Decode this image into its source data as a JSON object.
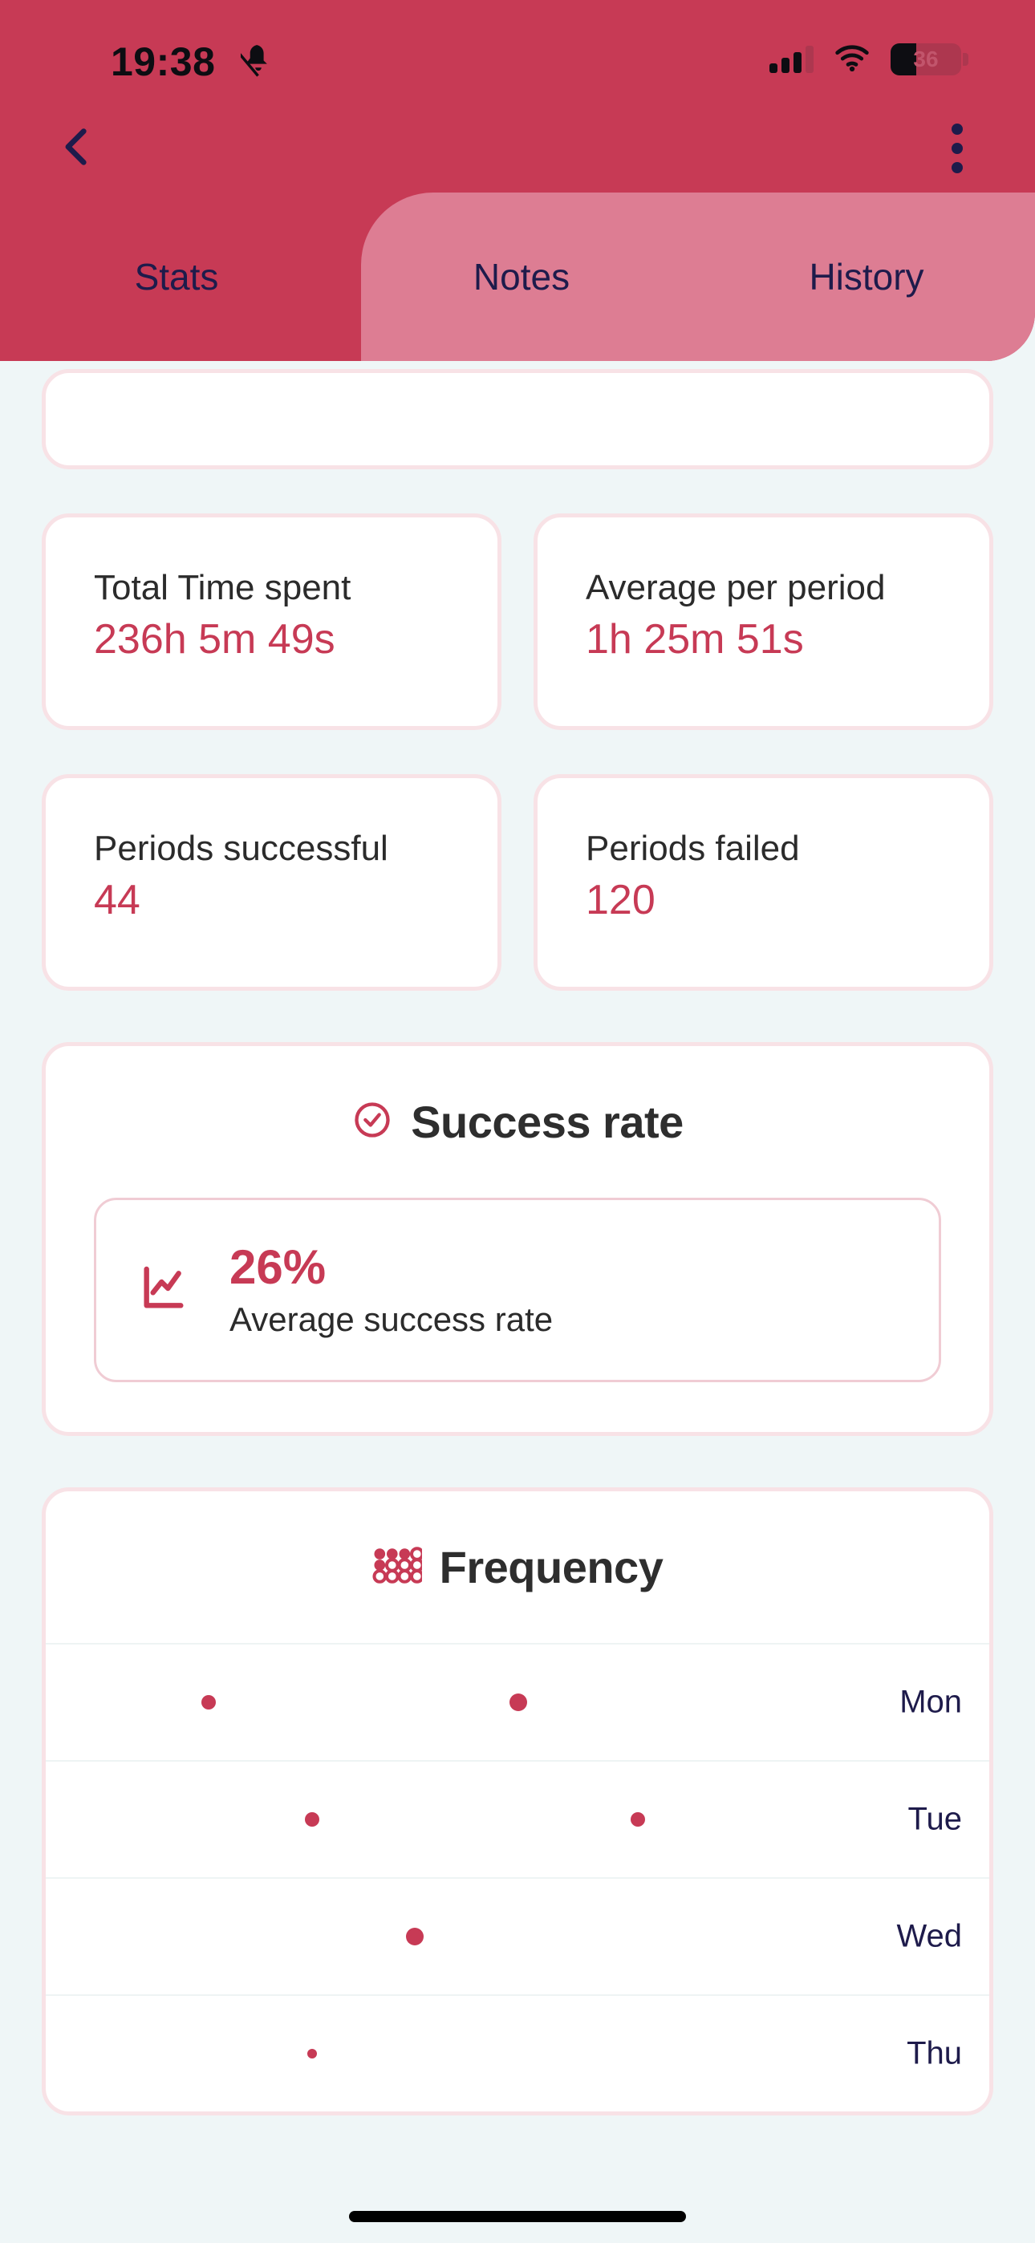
{
  "status_bar": {
    "time": "19:38",
    "notifications_icon": "bell-off-icon",
    "signal_icon": "signal-bars-icon",
    "wifi_icon": "wifi-icon",
    "battery_percent": "36",
    "battery_icon": "battery-icon"
  },
  "nav": {
    "back_icon": "chevron-left-icon",
    "overflow_icon": "more-vertical-icon"
  },
  "tabs": [
    {
      "label": "Stats",
      "active": true
    },
    {
      "label": "Notes",
      "active": false
    },
    {
      "label": "History",
      "active": false
    }
  ],
  "stat_cards": [
    {
      "label": "Total Time spent",
      "value": "236h 5m 49s"
    },
    {
      "label": "Average per period",
      "value": "1h 25m 51s"
    },
    {
      "label": "Periods successful",
      "value": "44"
    },
    {
      "label": "Periods failed",
      "value": "120"
    }
  ],
  "success_rate": {
    "title": "Success rate",
    "title_icon": "check-circle-icon",
    "chart_icon": "line-chart-icon",
    "value": "26%",
    "caption": "Average success rate"
  },
  "frequency": {
    "title": "Frequency",
    "title_icon": "dot-grid-icon"
  },
  "colors": {
    "accent": "#c73a55",
    "header": "#c73a55",
    "tab_panel": "#dd7d93",
    "page_background": "#eff6f7",
    "card_border": "#f8e2e6",
    "tab_text": "#1e1b4b",
    "label_text": "#2b2b2b"
  },
  "chart_data": {
    "type": "scatter",
    "title": "Frequency",
    "xlabel": "",
    "ylabel": "",
    "categories": [
      "Mon",
      "Tue",
      "Wed",
      "Thu"
    ],
    "grid": true,
    "legend": "none",
    "xlim": [
      0,
      100
    ],
    "series": [
      {
        "name": "Mon",
        "points": [
          {
            "x": 19,
            "size": 9
          },
          {
            "x": 55,
            "size": 11
          }
        ]
      },
      {
        "name": "Tue",
        "points": [
          {
            "x": 31,
            "size": 9
          },
          {
            "x": 69,
            "size": 9
          }
        ]
      },
      {
        "name": "Wed",
        "points": [
          {
            "x": 43,
            "size": 11
          }
        ]
      },
      {
        "name": "Thu",
        "points": [
          {
            "x": 31,
            "size": 6
          }
        ]
      }
    ]
  }
}
